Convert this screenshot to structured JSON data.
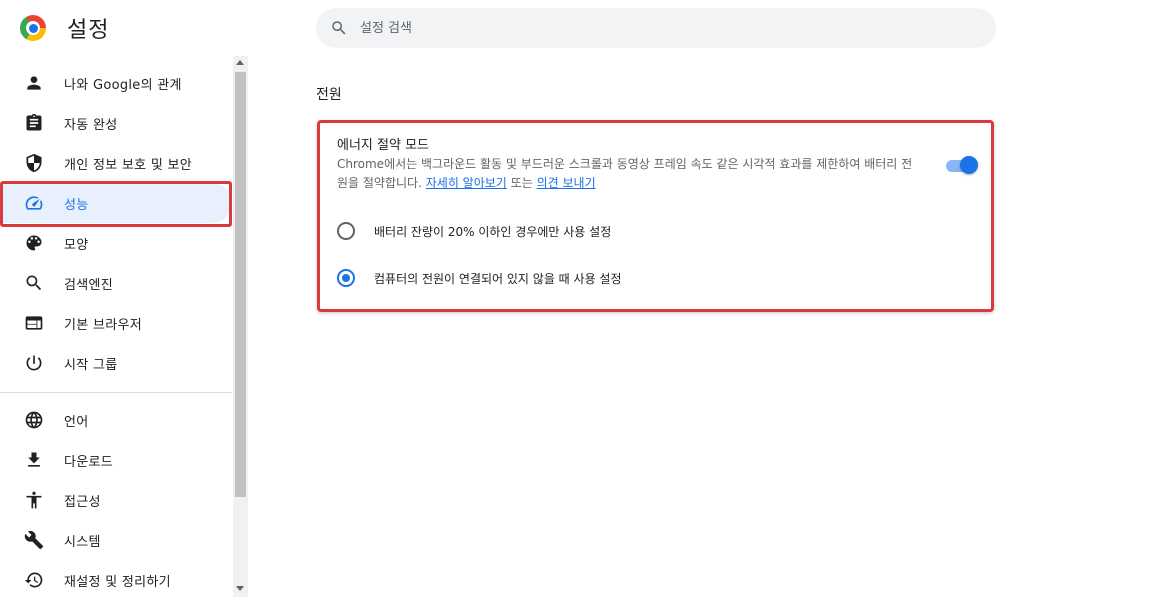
{
  "header": {
    "title": "설정",
    "search_placeholder": "설정 검색",
    "logo_icon": "chrome-logo-icon"
  },
  "sidebar": {
    "items": [
      {
        "label": "나와 Google의 관계",
        "icon": "person-icon"
      },
      {
        "label": "자동 완성",
        "icon": "clipboard-icon"
      },
      {
        "label": "개인 정보 보호 및 보안",
        "icon": "shield-icon"
      },
      {
        "label": "성능",
        "icon": "speedometer-icon",
        "active": true
      },
      {
        "label": "모양",
        "icon": "palette-icon"
      },
      {
        "label": "검색엔진",
        "icon": "search-icon"
      },
      {
        "label": "기본 브라우저",
        "icon": "browser-window-icon"
      },
      {
        "label": "시작 그룹",
        "icon": "power-icon"
      },
      {
        "label": "언어",
        "icon": "globe-icon"
      },
      {
        "label": "다운로드",
        "icon": "download-icon"
      },
      {
        "label": "접근성",
        "icon": "accessibility-icon"
      },
      {
        "label": "시스템",
        "icon": "wrench-icon"
      },
      {
        "label": "재설정 및 정리하기",
        "icon": "history-icon"
      }
    ]
  },
  "main": {
    "section_title": "전원",
    "energy_saver": {
      "title": "에너지 절약 모드",
      "description": "Chrome에서는 백그라운드 활동 및 부드러운 스크롤과 동영상 프레임 속도 같은 시각적 효과를 제한하여 배터리 전원을 절약합니다.",
      "learn_more_link": "자세히 알아보기",
      "conjunction": "또는",
      "feedback_link": "의견 보내기",
      "toggle_on": true,
      "options": [
        {
          "label": "배터리 잔량이 20% 이하인 경우에만 사용 설정",
          "checked": false
        },
        {
          "label": "컴퓨터의 전원이 연결되어 있지 않을 때 사용 설정",
          "checked": true
        }
      ]
    }
  },
  "colors": {
    "accent": "#1a73e8",
    "highlight_border": "#d93a3f",
    "active_bg": "#e8f0fe"
  }
}
